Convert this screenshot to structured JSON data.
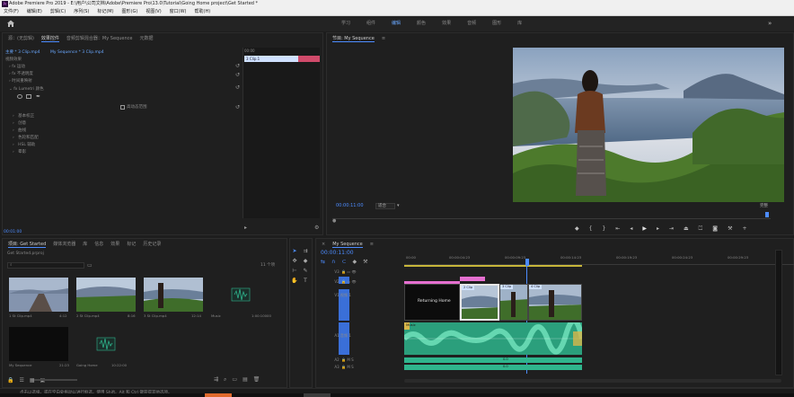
{
  "window": {
    "title": "Adobe Premiere Pro 2019 - E:\\用户\\公司文档\\Adobe\\Premiere Pro\\13.0\\Tutorial\\Going Home project\\Get Started *"
  },
  "menu": [
    "文件(F)",
    "编辑(E)",
    "剪辑(C)",
    "序列(S)",
    "标记(M)",
    "图形(G)",
    "视图(V)",
    "窗口(W)",
    "帮助(H)"
  ],
  "workspaces": [
    "学习",
    "组件",
    "编辑",
    "颜色",
    "效果",
    "音频",
    "图形",
    "库"
  ],
  "workspace_active": "编辑",
  "source_panel": {
    "tabs": [
      "源：(无剪辑)",
      "效果控件",
      "音频剪辑混合器：My Sequence",
      "元数据"
    ],
    "active_tab": "效果控件",
    "master_label": "主要 * 3 Clip.mp4",
    "sequence_label": "My Sequence * 3 Clip.mp4",
    "section_video": "视频效果",
    "fx_motion": "运动",
    "fx_opacity": "不透明度",
    "fx_time_remap": "时间重映射",
    "fx_lumetri": "Lumetri 颜色",
    "hdr_checkbox": "高动态范围",
    "lumetri_sections": [
      "基本校正",
      "创意",
      "曲线",
      "色轮和匹配",
      "HSL 辅助",
      "晕影"
    ],
    "mini_timecode_start": "00:00",
    "mini_clip_label": "3 Clip.1",
    "timecode": "00:01:00"
  },
  "program_monitor": {
    "tab": "节目: My Sequence",
    "timecode": "00:00:11:00",
    "fit": "适合",
    "fit_arrow": "▾",
    "quality": "完整"
  },
  "project_panel": {
    "tabs": [
      "项目: Get Started",
      "媒体浏览器",
      "库",
      "信息",
      "效果",
      "标记",
      "历史记录"
    ],
    "breadcrumb": "Get Started.prproj",
    "item_count": "11 个项",
    "items": [
      {
        "name": "1 St Clip.mp4",
        "duration": "4:12"
      },
      {
        "name": "2 St Clip.mp4",
        "duration": "8:16"
      },
      {
        "name": "3 St Clip.mp4",
        "duration": "12:14"
      },
      {
        "name": "Music",
        "duration": "1:00:10000"
      },
      {
        "name": "My Sequence",
        "duration": "21:23"
      },
      {
        "name": "Going Home",
        "duration": "10:22:00"
      }
    ]
  },
  "timeline": {
    "tab": "My Sequence",
    "timecode": "00:00:11:00",
    "ruler": [
      "00:00",
      "00:00:04:23",
      "00:00:09:23",
      "00:00:14:23",
      "00:00:19:23",
      "00:00:24:23",
      "00:00:29:23"
    ],
    "tracks": [
      {
        "id": "V3",
        "name": ""
      },
      {
        "id": "V2",
        "name": ""
      },
      {
        "id": "V1",
        "name": "视频 1"
      },
      {
        "id": "A1",
        "name": "音频 1"
      },
      {
        "id": "A2",
        "name": ""
      },
      {
        "id": "A3",
        "name": ""
      }
    ],
    "clips": {
      "title1": "Returning Home",
      "title_center": "Returning Home",
      "clip2": "2 Clip",
      "clip3": "3 Clip",
      "clip4": "4 Clip",
      "audio_title": "Music"
    },
    "volume_labels": [
      "0.0",
      "0.0"
    ]
  },
  "statusbar": {
    "text": "点击以选择，或在空白处拖动以进行框选。使用 Shift、Alt 和 Ctrl 键获得其他选项。"
  },
  "colors": {
    "accent": "#4d8cff",
    "audio_clip": "#2fb58d",
    "title_clip": "#e56fd0",
    "video_clip": "#3a6fd8"
  }
}
